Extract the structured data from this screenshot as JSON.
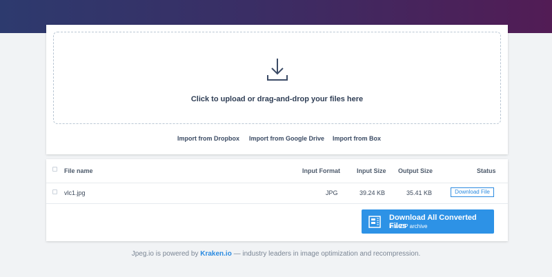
{
  "upload": {
    "text": "Click to upload or drag-and-drop your files here",
    "icon": "download-arrow-icon"
  },
  "imports": {
    "dropbox": "Import from Dropbox",
    "google_drive": "Import from Google Drive",
    "box": "Import from Box"
  },
  "table": {
    "headers": {
      "file_name": "File name",
      "input_format": "Input Format",
      "input_size": "Input Size",
      "output_size": "Output Size",
      "status": "Status"
    },
    "rows": [
      {
        "file_name": "vlc1.jpg",
        "input_format": "JPG",
        "input_size": "39.24 KB",
        "output_size": "35.41 KB",
        "status_button": "Download File"
      }
    ]
  },
  "download_all": {
    "title": "Download All Converted Files",
    "subtitle": "in a ZIP archive",
    "icon": "zip-archive-icon"
  },
  "footer": {
    "prefix": "Jpeg.io is powered by",
    "link": "Kraken.io",
    "suffix": "— industry leaders in image optimization and recompression."
  },
  "colors": {
    "header_gradient_start": "#2d3a6e",
    "header_gradient_end": "#521c55",
    "accent": "#2d92e6",
    "background": "#f1f3f5"
  }
}
